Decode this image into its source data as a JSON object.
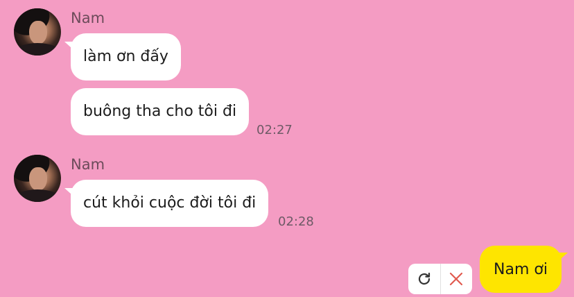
{
  "messages": [
    {
      "sender": "Nam",
      "texts": [
        "làm ơn đấy",
        "buông tha cho tôi đi"
      ],
      "time": "02:27"
    },
    {
      "sender": "Nam",
      "texts": [
        "cút khỏi cuộc đời tôi đi"
      ],
      "time": "02:28"
    }
  ],
  "outgoing": {
    "text": "Nam ơi"
  },
  "colors": {
    "background": "#f49cc3",
    "outgoing_bubble": "#fee500",
    "incoming_bubble": "#ffffff",
    "retry_icon": "#333333",
    "delete_icon": "#e05a4f"
  },
  "icons": {
    "retry": "refresh-icon",
    "delete": "close-icon"
  }
}
